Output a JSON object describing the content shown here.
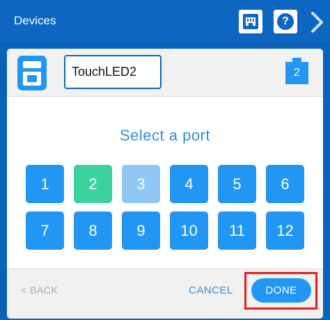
{
  "header": {
    "title": "Devices",
    "help_label": "?",
    "icons": [
      "device-port-icon",
      "help-icon",
      "chevron-right-icon"
    ]
  },
  "dialog": {
    "device_name": "TouchLED2",
    "port_badge": "2",
    "prompt": "Select a port",
    "ports": [
      {
        "label": "1",
        "state": "available"
      },
      {
        "label": "2",
        "state": "selected"
      },
      {
        "label": "3",
        "state": "disabled"
      },
      {
        "label": "4",
        "state": "available"
      },
      {
        "label": "5",
        "state": "available"
      },
      {
        "label": "6",
        "state": "available"
      },
      {
        "label": "7",
        "state": "available"
      },
      {
        "label": "8",
        "state": "available"
      },
      {
        "label": "9",
        "state": "available"
      },
      {
        "label": "10",
        "state": "available"
      },
      {
        "label": "11",
        "state": "available"
      },
      {
        "label": "12",
        "state": "available"
      }
    ],
    "back_label": "< BACK",
    "cancel_label": "CANCEL",
    "done_label": "DONE"
  },
  "colors": {
    "primary": "#2196f3",
    "selected": "#3cd19e",
    "disabled": "#90c8f5",
    "header": "#0d66c2",
    "highlight": "#e5201b"
  }
}
